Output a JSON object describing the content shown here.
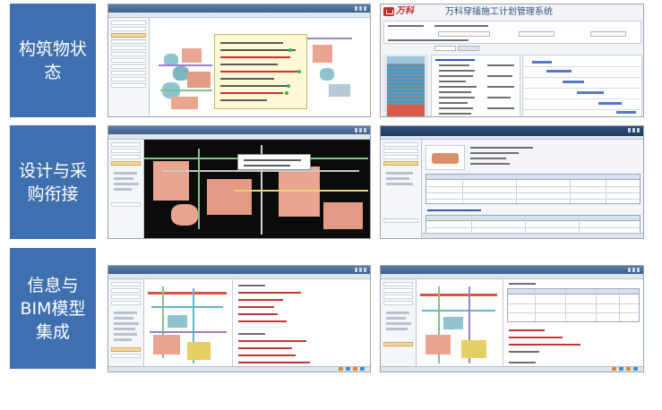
{
  "labels": [
    "构筑物状\n态",
    "设计与采\n购衔接",
    "信息与\nBIM模型\n集成"
  ],
  "screens": {
    "plan_logo_text": "万科",
    "plan_app_title": "万科穿插施工计划管理系统"
  },
  "colors": {
    "label_bg": "#3e6fae",
    "titlebar": "#3d5f8c",
    "equipment_salmon": "#e9a58f",
    "equipment_teal": "#8fc4cf",
    "logo_red": "#c42b2b"
  },
  "icons": [
    "window-controls-icon",
    "app-logo-icon",
    "status-icon",
    "tree-node-icon"
  ]
}
